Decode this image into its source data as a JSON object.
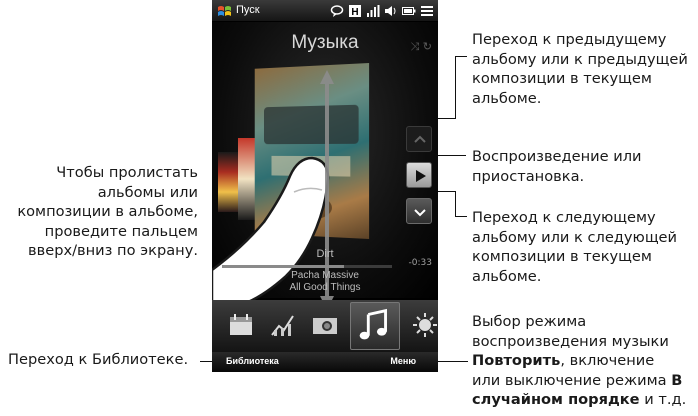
{
  "phone": {
    "status": {
      "start_label": "Пуск"
    },
    "title": "Музыка",
    "track": {
      "title": "Dirt",
      "artist": "Pacha Massive",
      "album": "All Good Things",
      "remaining": "-0:33",
      "progress": 0.72
    },
    "tabs": [
      "calendar-icon",
      "stocks-icon",
      "photos-icon",
      "music-icon",
      "weather-icon"
    ],
    "softkeys": {
      "left": "Библиотека",
      "right": "Меню"
    }
  },
  "notes": {
    "swipe": [
      "Чтобы пролистать",
      "альбомы или",
      "композиции в альбоме,",
      "проведите пальцем",
      "вверх/вниз по экрану."
    ],
    "library": "Переход к Библиотеке.",
    "prev": [
      "Переход к предыдущему",
      "альбому или к предыдущей",
      "композиции в текущем",
      "альбоме."
    ],
    "play": [
      "Воспроизведение или",
      "приостановка."
    ],
    "next": [
      "Переход к следующему",
      "альбому или к следующей",
      "композиции в текущем",
      "альбоме."
    ],
    "menu": {
      "line1": "Выбор режима",
      "line2": "воспроизведения музыки",
      "line3_bold": "Повторить",
      "line3_rest": ", включение",
      "line4_pre": "или выключение режима ",
      "line4_bold": "В",
      "line5_bold": "случайном порядке",
      "line5_rest": " и т.д."
    }
  },
  "colors": {
    "screen_bg": "#000000",
    "text": "#1a1a1a",
    "accent": "#ffffff"
  }
}
